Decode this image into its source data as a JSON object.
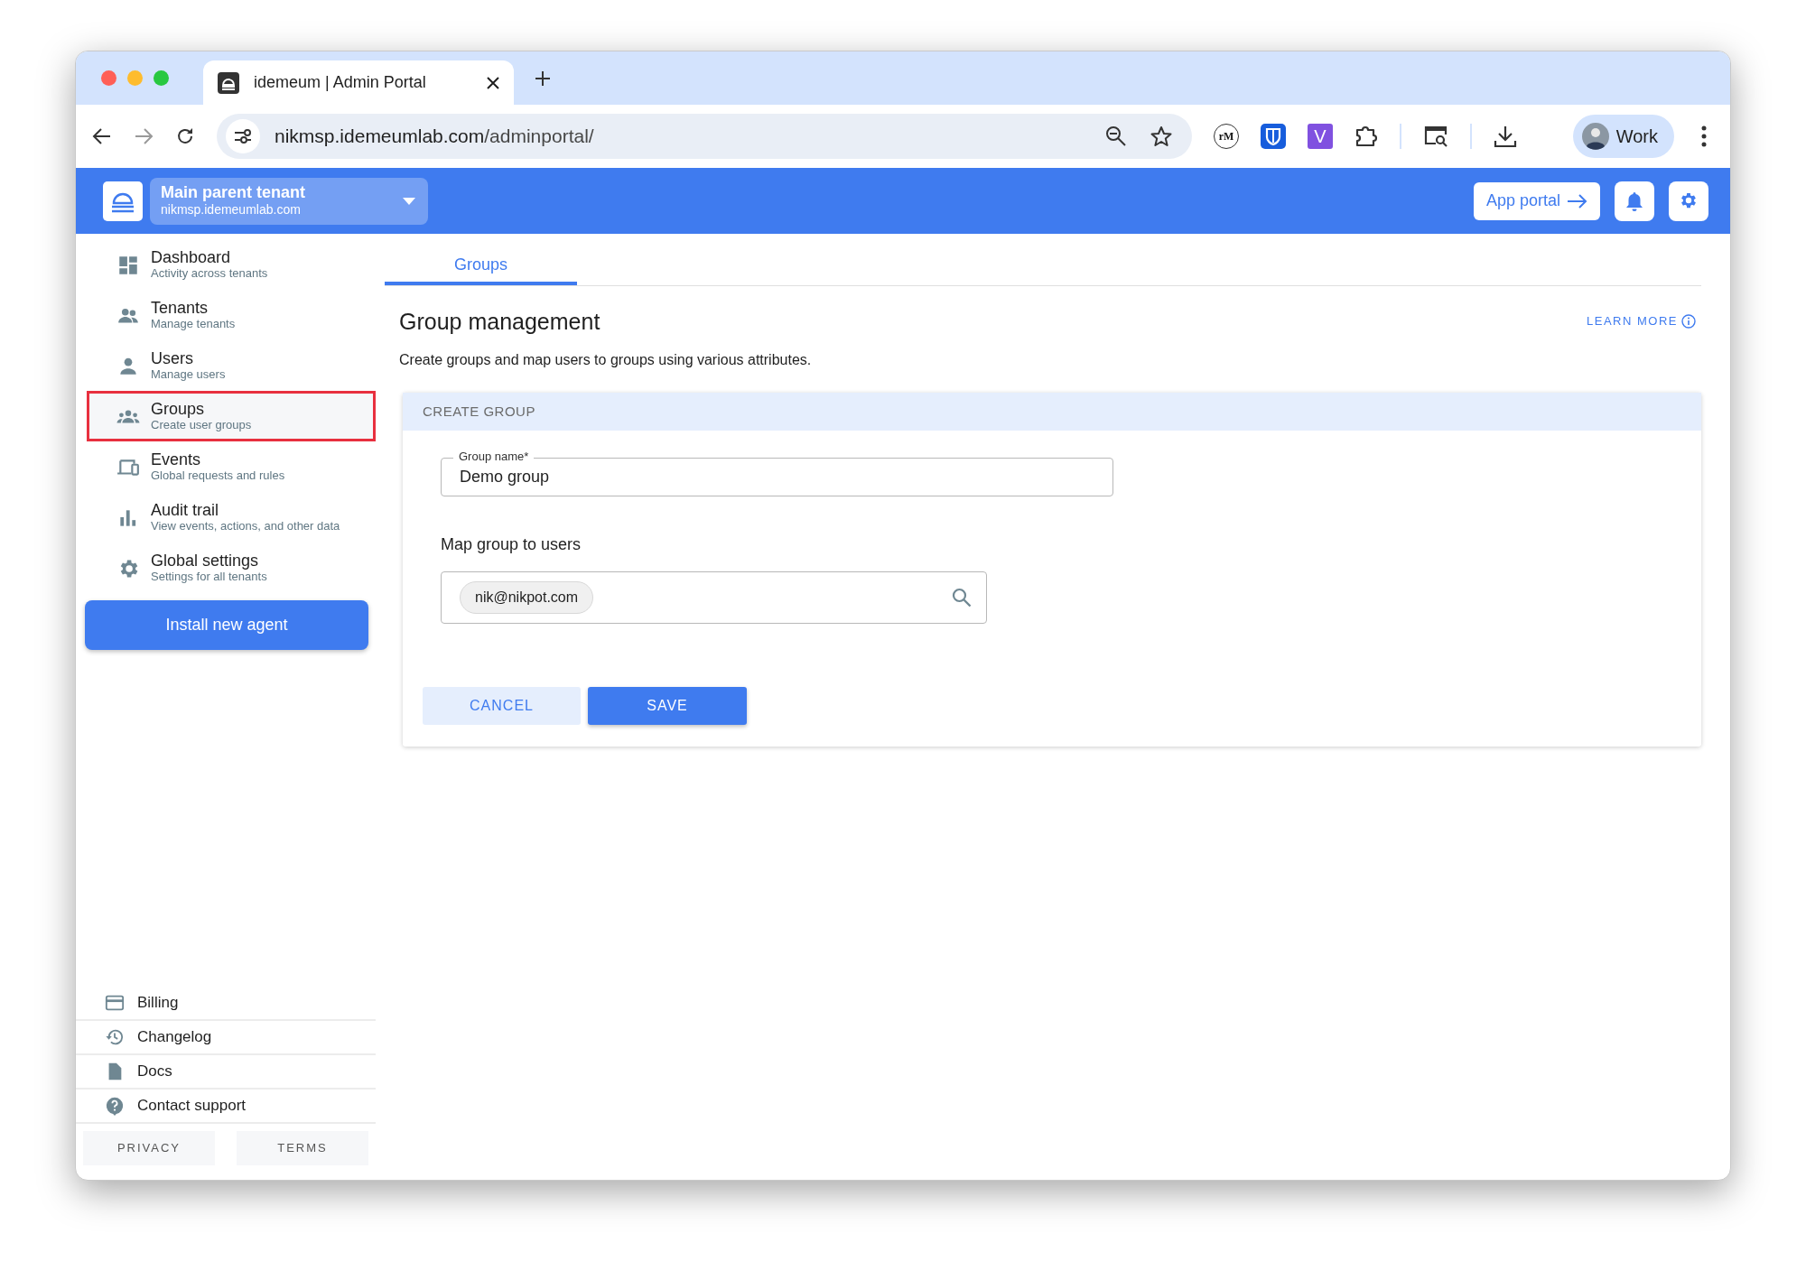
{
  "browser": {
    "tab_title": "idemeum | Admin Portal",
    "url_host": "nikmsp.idemeumlab.com",
    "url_path": "/adminportal/",
    "extensions": [
      {
        "kind": "remarkable",
        "label": "rM"
      },
      {
        "kind": "shield"
      },
      {
        "kind": "letter",
        "label": "V"
      },
      {
        "kind": "puzzle"
      }
    ],
    "profile": "Work"
  },
  "header": {
    "tenant_name": "Main parent tenant",
    "tenant_domain": "nikmsp.idemeumlab.com",
    "app_portal": "App portal"
  },
  "sidebar": {
    "items": [
      {
        "kind": "dashboard",
        "title": "Dashboard",
        "subtitle": "Activity across tenants",
        "selected": false
      },
      {
        "kind": "tenants",
        "title": "Tenants",
        "subtitle": "Manage tenants",
        "selected": false
      },
      {
        "kind": "users",
        "title": "Users",
        "subtitle": "Manage users",
        "selected": false
      },
      {
        "kind": "groups",
        "title": "Groups",
        "subtitle": "Create user groups",
        "selected": true
      },
      {
        "kind": "events",
        "title": "Events",
        "subtitle": "Global requests and rules",
        "selected": false
      },
      {
        "kind": "audit",
        "title": "Audit trail",
        "subtitle": "View events, actions, and other data",
        "selected": false
      },
      {
        "kind": "settings",
        "title": "Global settings",
        "subtitle": "Settings for all tenants",
        "selected": false
      }
    ],
    "install_button": "Install new agent",
    "footer_links": [
      {
        "kind": "billing",
        "label": "Billing"
      },
      {
        "kind": "changelog",
        "label": "Changelog"
      },
      {
        "kind": "docs",
        "label": "Docs"
      },
      {
        "kind": "support",
        "label": "Contact support"
      }
    ],
    "legal_links": [
      "PRIVACY",
      "TERMS"
    ]
  },
  "main": {
    "tabs": [
      {
        "label": "Groups",
        "selected": true
      }
    ],
    "title": "Group management",
    "learn_more": "LEARN MORE",
    "description": "Create groups and map users to groups using various attributes.",
    "card": {
      "header": "CREATE GROUP",
      "group_name_label": "Group name*",
      "group_name_value": "Demo group",
      "map_label": "Map group to users",
      "user_chips": [
        "nik@nikpot.com"
      ],
      "cancel": "CANCEL",
      "save": "SAVE"
    }
  }
}
